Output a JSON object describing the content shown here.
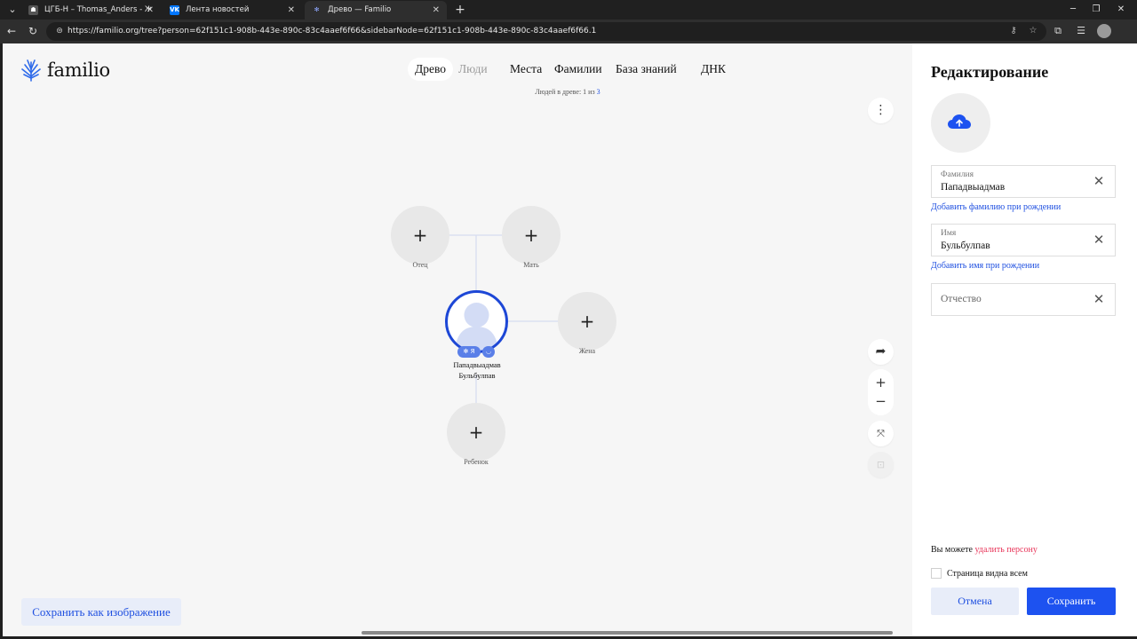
{
  "browser": {
    "tabs": [
      {
        "title": "ЦГБ-Н – Thomas_Anders - Жалоба",
        "favicon": "forum-favicon",
        "active": false
      },
      {
        "title": "Лента новостей",
        "favicon": "vk-favicon",
        "favicon_text": "VK",
        "active": false
      },
      {
        "title": "Древо — Familio",
        "favicon": "familio-favicon",
        "active": true
      }
    ],
    "url": "https://familio.org/tree?person=62f151c1-908b-443e-890c-83c4aaef6f66&sidebarNode=62f151c1-908b-443e-890c-83c4aaef6f66.1"
  },
  "site": {
    "logo_text": "familio",
    "nav": [
      {
        "label": "Древо",
        "active": true
      },
      {
        "label": "Люди",
        "muted": true
      },
      {
        "label": "Места"
      },
      {
        "label": "Фамилии"
      },
      {
        "label": "База знаний"
      },
      {
        "label": "ДНК"
      }
    ],
    "people_count_prefix": "Людей в древе: ",
    "people_count_current": "1",
    "people_count_sep": " из ",
    "people_count_total": "3"
  },
  "tree": {
    "father_label": "Отец",
    "mother_label": "Мать",
    "wife_label": "Жена",
    "child_label": "Ребенок",
    "person_name_line1": "Пападвыадмав",
    "person_name_line2": "Бульбулпав",
    "me_badge": "Я",
    "add_glyph": "+"
  },
  "save_image_label": "Сохранить как изображение",
  "panel": {
    "title": "Редактирование",
    "surname_label": "Фамилия",
    "surname_value": "Пападвыадмав",
    "add_birth_surname": "Добавить фамилию при рождении",
    "name_label": "Имя",
    "name_value": "Бульбулпав",
    "add_birth_name": "Добавить имя при рождении",
    "patronymic_placeholder": "Отчество",
    "delete_prefix": "Вы можете ",
    "delete_link": "удалить персону",
    "visible_label": "Страница видна всем",
    "visible_checked": false,
    "cancel_label": "Отмена",
    "save_label": "Сохранить"
  },
  "colors": {
    "accent": "#1d52f0",
    "delete": "#e8365a",
    "link": "#1e4fe0"
  }
}
